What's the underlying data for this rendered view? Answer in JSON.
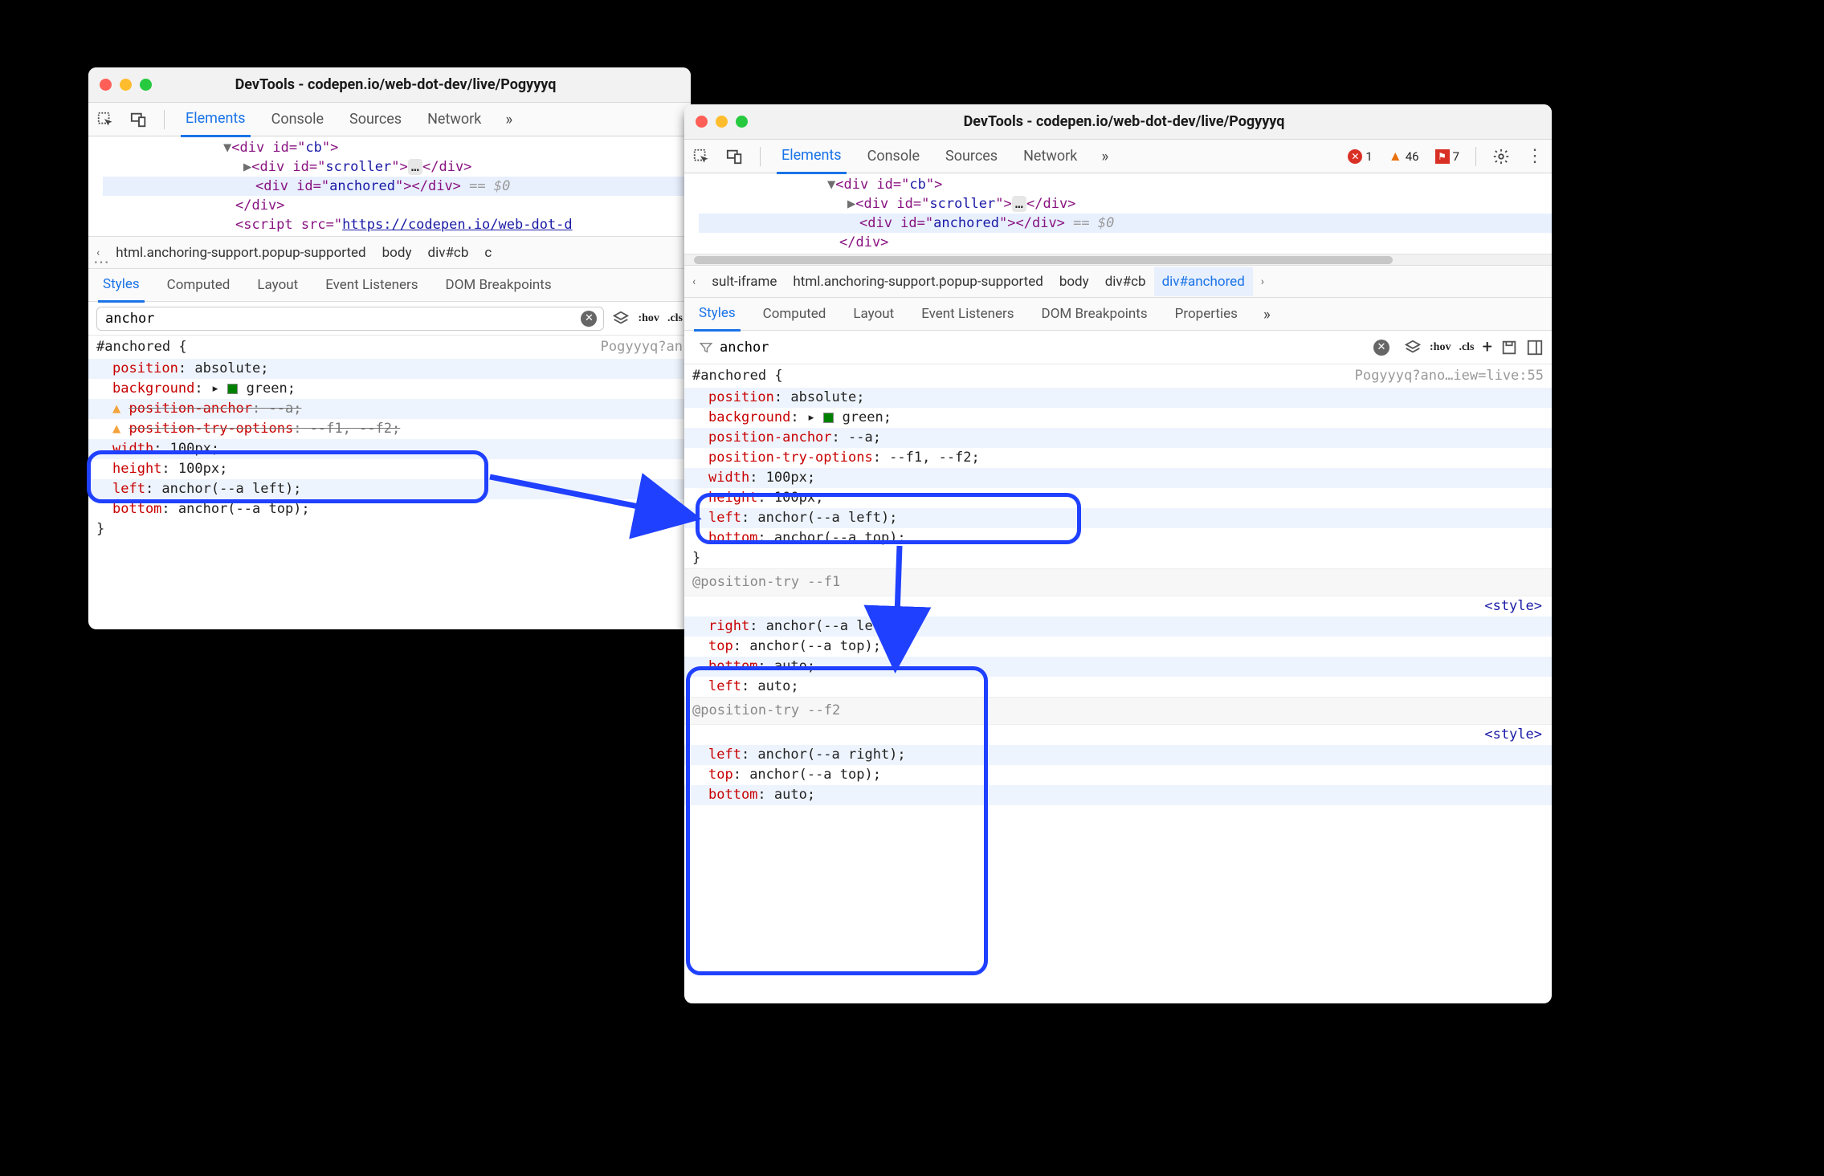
{
  "windowLeft": {
    "title": "DevTools - codepen.io/web-dot-dev/live/Pogyyyq",
    "tabs": [
      "Elements",
      "Console",
      "Sources",
      "Network"
    ],
    "activeTab": "Elements",
    "html": {
      "l1_pre": "<div id=\"",
      "l1_id": "cb",
      "l1_post": "\">",
      "l2_pre": "<div id=\"",
      "l2_id": "scroller",
      "l2_post": "\">",
      "l2_ell": "…",
      "l2_close": "</div>",
      "l3_pre": "<div id=\"",
      "l3_id": "anchored",
      "l3_post": "\">",
      "l3_close": "</div>",
      "l3_eq": " == $0",
      "l4": "</div>",
      "l5_pre": "<script src=\"",
      "l5_url": "https://codepen.io/web-dot-d"
    },
    "breadcrumb": [
      "html.anchoring-support.popup-supported",
      "body",
      "div#cb"
    ],
    "subtabs": [
      "Styles",
      "Computed",
      "Layout",
      "Event Listeners",
      "DOM Breakpoints"
    ],
    "activeSubtab": "Styles",
    "filterValue": "anchor",
    "hov": ":hov",
    "cls": ".cls",
    "selector": "#anchored {",
    "sourcelink": "Pogyyyq?an",
    "rules": [
      {
        "prop": "position",
        "val": ": absolute;"
      },
      {
        "prop": "background",
        "val": ": ▸ "
      },
      {
        "prop2": "green",
        "post": ";",
        "swatch": true
      },
      {
        "prop": "position-anchor",
        "val": ": --a;",
        "strike": true,
        "warn": true
      },
      {
        "prop": "position-try-options",
        "val": ": --f1, --f2;",
        "strike": true,
        "warn": true
      },
      {
        "prop": "width",
        "val": ": 100px;"
      },
      {
        "prop": "height",
        "val": ": 100px;"
      },
      {
        "prop": "left",
        "val": ": anchor(--a left);"
      },
      {
        "prop": "bottom",
        "val": ": anchor(--a top);"
      }
    ],
    "closeBrace": "}"
  },
  "windowRight": {
    "title": "DevTools - codepen.io/web-dot-dev/live/Pogyyyq",
    "tabs": [
      "Elements",
      "Console",
      "Sources",
      "Network"
    ],
    "activeTab": "Elements",
    "errors": {
      "err": "1",
      "warn": "46",
      "issue": "7"
    },
    "html": {
      "l1_pre": "<div id=\"",
      "l1_id": "cb",
      "l1_post": "\">",
      "l2_pre": "<div id=\"",
      "l2_id": "scroller",
      "l2_post": "\">",
      "l2_ell": "…",
      "l2_close": "</div>",
      "l3_pre": "<div id=\"",
      "l3_id": "anchored",
      "l3_post": "\">",
      "l3_close": "</div>",
      "l3_eq": " == $0",
      "l4": "</div>"
    },
    "breadcrumb": [
      "sult-iframe",
      "html.anchoring-support.popup-supported",
      "body",
      "div#cb",
      "div#anchored"
    ],
    "subtabs": [
      "Styles",
      "Computed",
      "Layout",
      "Event Listeners",
      "DOM Breakpoints",
      "Properties"
    ],
    "activeSubtab": "Styles",
    "filterValue": "anchor",
    "hov": ":hov",
    "cls": ".cls",
    "selector": "#anchored {",
    "sourcelink": "Pogyyyq?ano…iew=live:55",
    "rules": [
      {
        "prop": "position",
        "val": ": absolute;"
      },
      {
        "prop": "background",
        "val": ": ▸ ",
        "prop2": "green",
        "post": ";",
        "swatch": true
      },
      {
        "prop": "position-anchor",
        "val": ": --a;"
      },
      {
        "prop": "position-try-options",
        "val": ": --f1, --f2;"
      },
      {
        "prop": "width",
        "val": ": 100px;"
      },
      {
        "prop": "height",
        "val": ": 100px;"
      },
      {
        "prop": "left",
        "val": ": anchor(--a left);"
      },
      {
        "prop": "bottom",
        "val": ": anchor(--a top);"
      }
    ],
    "closeBrace": "}",
    "posTry1Header": "@position-try --f1",
    "styleLink": "<style>",
    "posTry1": [
      {
        "prop": "right",
        "val": ": anchor(--a left);"
      },
      {
        "prop": "top",
        "val": ": anchor(--a top);"
      },
      {
        "prop": "bottom",
        "val": ": auto;"
      },
      {
        "prop": "left",
        "val": ": auto;"
      }
    ],
    "posTry2Header": "@position-try --f2",
    "posTry2": [
      {
        "prop": "left",
        "val": ": anchor(--a right);"
      },
      {
        "prop": "top",
        "val": ": anchor(--a top);"
      },
      {
        "prop": "bottom",
        "val": ": auto;"
      }
    ]
  }
}
